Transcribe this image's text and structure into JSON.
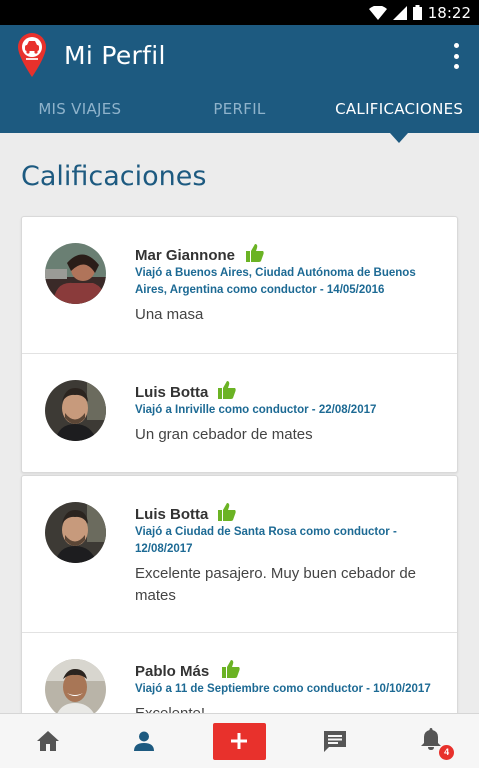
{
  "status_bar": {
    "time": "18:22"
  },
  "app_bar": {
    "title": "Mi Perfil"
  },
  "tabs": [
    {
      "label": "MIS VIAJES",
      "active": false
    },
    {
      "label": "PERFIL",
      "active": false
    },
    {
      "label": "CALIFICACIONES",
      "active": true
    }
  ],
  "page": {
    "title": "Calificaciones"
  },
  "ratings": [
    {
      "name": "Mar Giannone",
      "trip": "Viajó a Buenos Aires, Ciudad Autónoma de Buenos Aires, Argentina como conductor - 14/05/2016",
      "comment": "Una masa",
      "thumb": "thumbs-up-icon"
    },
    {
      "name": "Luis Botta",
      "trip": "Viajó a Inriville como conductor - 22/08/2017",
      "comment": "Un gran cebador de mates",
      "thumb": "thumbs-up-icon"
    },
    {
      "name": "Luis Botta",
      "trip": "Viajó a Ciudad de Santa Rosa como conductor - 12/08/2017",
      "comment": "Excelente pasajero. Muy buen cebador de mates",
      "thumb": "thumbs-up-icon"
    },
    {
      "name": "Pablo Más",
      "trip": "Viajó a 11 de Septiembre como conductor - 10/10/2017",
      "comment": "Excelente!",
      "thumb": "thumbs-up-icon"
    }
  ],
  "bottom_nav": {
    "items": [
      "home-icon",
      "person-icon",
      "plus-icon",
      "chat-icon",
      "bell-icon"
    ],
    "notifications_count": "4"
  },
  "colors": {
    "primary": "#1d5a80",
    "accent": "#e8312c",
    "thumb": "#6bb324",
    "trip_text": "#1d6a94"
  }
}
